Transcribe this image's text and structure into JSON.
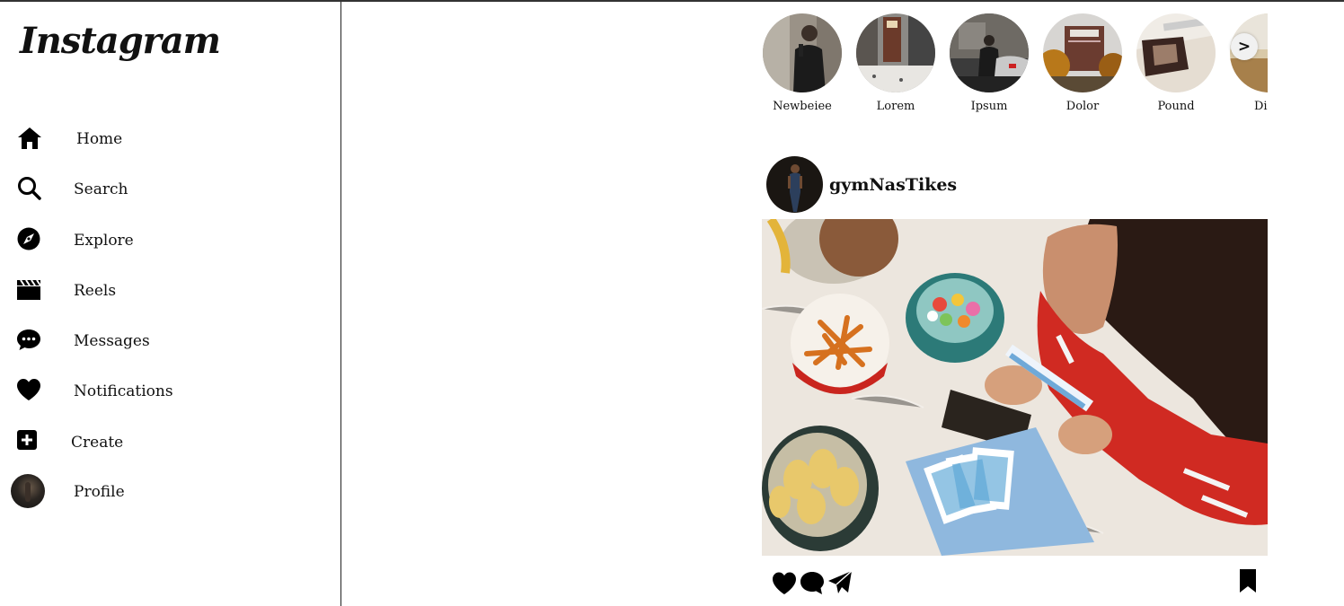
{
  "app": {
    "logo_text": "Instagram"
  },
  "sidebar": {
    "items": [
      {
        "label": "Home",
        "icon": "home-icon"
      },
      {
        "label": "Search",
        "icon": "search-icon"
      },
      {
        "label": "Explore",
        "icon": "compass-icon"
      },
      {
        "label": "Reels",
        "icon": "clapperboard-icon"
      },
      {
        "label": "Messages",
        "icon": "chat-bubble-icon"
      },
      {
        "label": "Notifications",
        "icon": "heart-icon"
      },
      {
        "label": "Create",
        "icon": "plus-square-icon"
      },
      {
        "label": "Profile",
        "icon": "profile-avatar"
      }
    ]
  },
  "stories": {
    "items": [
      {
        "label": "Newbeiee"
      },
      {
        "label": "Lorem"
      },
      {
        "label": "Ipsum"
      },
      {
        "label": "Dolor"
      },
      {
        "label": "Pound"
      },
      {
        "label": "Di"
      }
    ],
    "next_label": ">"
  },
  "post": {
    "username": "gymNasTikes",
    "actions": [
      "heart-icon",
      "comment-icon",
      "share-icon",
      "bookmark-icon"
    ]
  }
}
